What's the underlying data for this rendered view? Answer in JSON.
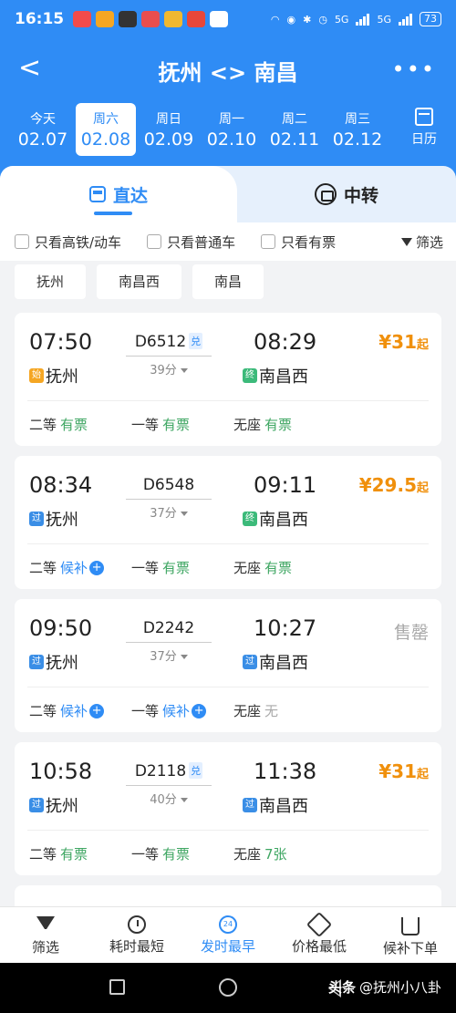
{
  "status": {
    "time": "16:15",
    "battery": "73",
    "network_a": "5G",
    "network_b": "5G"
  },
  "header": {
    "title": "抚州 <> 南昌",
    "back": "<",
    "more": "•••"
  },
  "dates": [
    {
      "week": "今天",
      "date": "02.07"
    },
    {
      "week": "周六",
      "date": "02.08"
    },
    {
      "week": "周日",
      "date": "02.09"
    },
    {
      "week": "周一",
      "date": "02.10"
    },
    {
      "week": "周二",
      "date": "02.11"
    },
    {
      "week": "周三",
      "date": "02.12"
    }
  ],
  "calendar_label": "日历",
  "tabs": {
    "direct": "直达",
    "transfer": "中转"
  },
  "filters": {
    "high_speed": "只看高铁/动车",
    "normal": "只看普通车",
    "available": "只看有票",
    "filter": "筛选"
  },
  "stations": [
    "抚州",
    "南昌西",
    "南昌"
  ],
  "trains": [
    {
      "dep_time": "07:50",
      "arr_time": "08:29",
      "train_no": "D6512",
      "duih": "兑",
      "duration": "39分",
      "dep_tag": "始",
      "dep_station": "抚州",
      "arr_tag": "终",
      "arr_station": "南昌西",
      "price": "¥31",
      "price_suffix": "起",
      "seats": [
        {
          "label": "二等",
          "status": "有票"
        },
        {
          "label": "一等",
          "status": "有票"
        },
        {
          "label": "无座",
          "status": "有票"
        }
      ]
    },
    {
      "dep_time": "08:34",
      "arr_time": "09:11",
      "train_no": "D6548",
      "duration": "37分",
      "dep_tag": "过",
      "dep_station": "抚州",
      "arr_tag": "终",
      "arr_station": "南昌西",
      "price": "¥29.5",
      "price_suffix": "起",
      "seats": [
        {
          "label": "二等",
          "status": "候补"
        },
        {
          "label": "一等",
          "status": "有票"
        },
        {
          "label": "无座",
          "status": "有票"
        }
      ]
    },
    {
      "dep_time": "09:50",
      "arr_time": "10:27",
      "train_no": "D2242",
      "duration": "37分",
      "dep_tag": "过",
      "dep_station": "抚州",
      "arr_tag": "过",
      "arr_station": "南昌西",
      "soldout": "售罄",
      "seats": [
        {
          "label": "二等",
          "status": "候补"
        },
        {
          "label": "一等",
          "status": "候补"
        },
        {
          "label": "无座",
          "status": "无"
        }
      ]
    },
    {
      "dep_time": "10:58",
      "arr_time": "11:38",
      "train_no": "D2118",
      "duih": "兑",
      "duration": "40分",
      "dep_tag": "过",
      "dep_station": "抚州",
      "arr_tag": "过",
      "arr_station": "南昌西",
      "price": "¥31",
      "price_suffix": "起",
      "seats": [
        {
          "label": "二等",
          "status": "有票"
        },
        {
          "label": "一等",
          "status": "有票"
        },
        {
          "label": "无座",
          "status": "7张"
        }
      ]
    }
  ],
  "plus_sign": "+",
  "bottom_tabs": {
    "filter": "筛选",
    "shortest": "耗时最短",
    "earliest": "发时最早",
    "cheapest": "价格最低",
    "waitlist": "候补下单",
    "badge": "24"
  },
  "watermark": {
    "brand": "头条",
    "account": "@抚州小八卦"
  },
  "colors": {
    "primary": "#2f8cf5",
    "price": "#f0900c",
    "available": "#3ea662"
  }
}
